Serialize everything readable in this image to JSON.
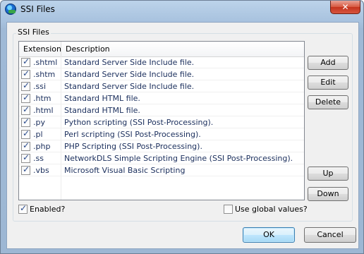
{
  "window": {
    "title": "SSI Files",
    "close_glyph": "✕",
    "icon": "app-globe-icon"
  },
  "group": {
    "label": "SSI Files"
  },
  "list": {
    "columns": [
      "Extension",
      "Description"
    ],
    "rows": [
      {
        "checked": true,
        "ext": ".shtml",
        "desc": "Standard Server Side Include file."
      },
      {
        "checked": true,
        "ext": ".shtm",
        "desc": "Standard Server Side Include file."
      },
      {
        "checked": true,
        "ext": ".ssi",
        "desc": "Standard Server Side Include file."
      },
      {
        "checked": true,
        "ext": ".htm",
        "desc": "Standard HTML file."
      },
      {
        "checked": true,
        "ext": ".html",
        "desc": "Standard HTML file."
      },
      {
        "checked": true,
        "ext": ".py",
        "desc": "Python scripting (SSI Post-Processing)."
      },
      {
        "checked": true,
        "ext": ".pl",
        "desc": "Perl scripting (SSI Post-Processing)."
      },
      {
        "checked": true,
        "ext": ".php",
        "desc": "PHP Scripting (SSI Post-Processing)."
      },
      {
        "checked": true,
        "ext": ".ss",
        "desc": "NetworkDLS Simple Scripting Engine (SSI Post-Processing)."
      },
      {
        "checked": true,
        "ext": ".vbs",
        "desc": "Microsoft Visual Basic Scripting"
      }
    ]
  },
  "buttons": {
    "add": "Add",
    "edit": "Edit",
    "delete": "Delete",
    "up": "Up",
    "down": "Down",
    "ok": "OK",
    "cancel": "Cancel"
  },
  "options": {
    "enabled": {
      "label": "Enabled?",
      "checked": true
    },
    "global": {
      "label": "Use global values?",
      "checked": false
    }
  }
}
